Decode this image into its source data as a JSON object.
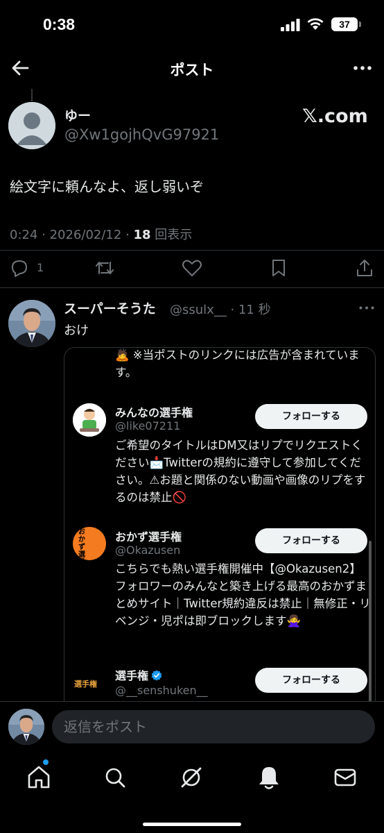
{
  "status_bar": {
    "time": "0:38",
    "battery": "37"
  },
  "header": {
    "title": "ポスト"
  },
  "post": {
    "author_name": "ゆー",
    "author_handle": "@Xw1gojhQvG97921",
    "badge": "𝕏.com",
    "text": "絵文字に頼んなよ、返し弱いぞ",
    "meta_time": "0:24 · 2026/02/12 · ",
    "meta_views_count": "18",
    "meta_views_label": " 回表示",
    "reply_count": "1"
  },
  "reply": {
    "author_name": "スーパーそうた",
    "author_handle": "@ssulx__ · 11 秒",
    "text": "おけ",
    "embed": {
      "top_text": "🙇 ※当ポストのリンクには広告が含まれています。",
      "accounts": [
        {
          "name": "みんなの選手権",
          "handle": "@like07211",
          "follow_label": "フォローする",
          "bio": "ご希望のタイトルはDM又はリプでリクエストください📩Twitterの規約に遵守して参加してください。⚠お題と関係のない動画や画像のリプをするのは禁止🚫",
          "verified": false
        },
        {
          "name": "おかず選手権",
          "handle": "@Okazusen",
          "follow_label": "フォローする",
          "bio": "こちらでも熱い選手権開催中【@Okazusen2】フォロワーのみんなと築き上げる最高のおかずまとめサイト｜Twitter規約違反は禁止｜無修正・リベンジ・児ポは即ブロックします🙅‍♀️",
          "avatar_text": "おかず選手権",
          "verified": false
        },
        {
          "name": "選手権",
          "handle": "@__senshuken__",
          "follow_label": "フォローする",
          "avatar_text": "選手権",
          "verified": true
        }
      ]
    }
  },
  "reply_bar": {
    "placeholder": "返信をポスト"
  },
  "tabs": [
    "home-icon",
    "search-icon",
    "grok-icon",
    "notifications-icon",
    "messages-icon"
  ],
  "colors": {
    "accent": "#1d9bf0",
    "background": "#000000",
    "secondary_text": "#71767b"
  }
}
